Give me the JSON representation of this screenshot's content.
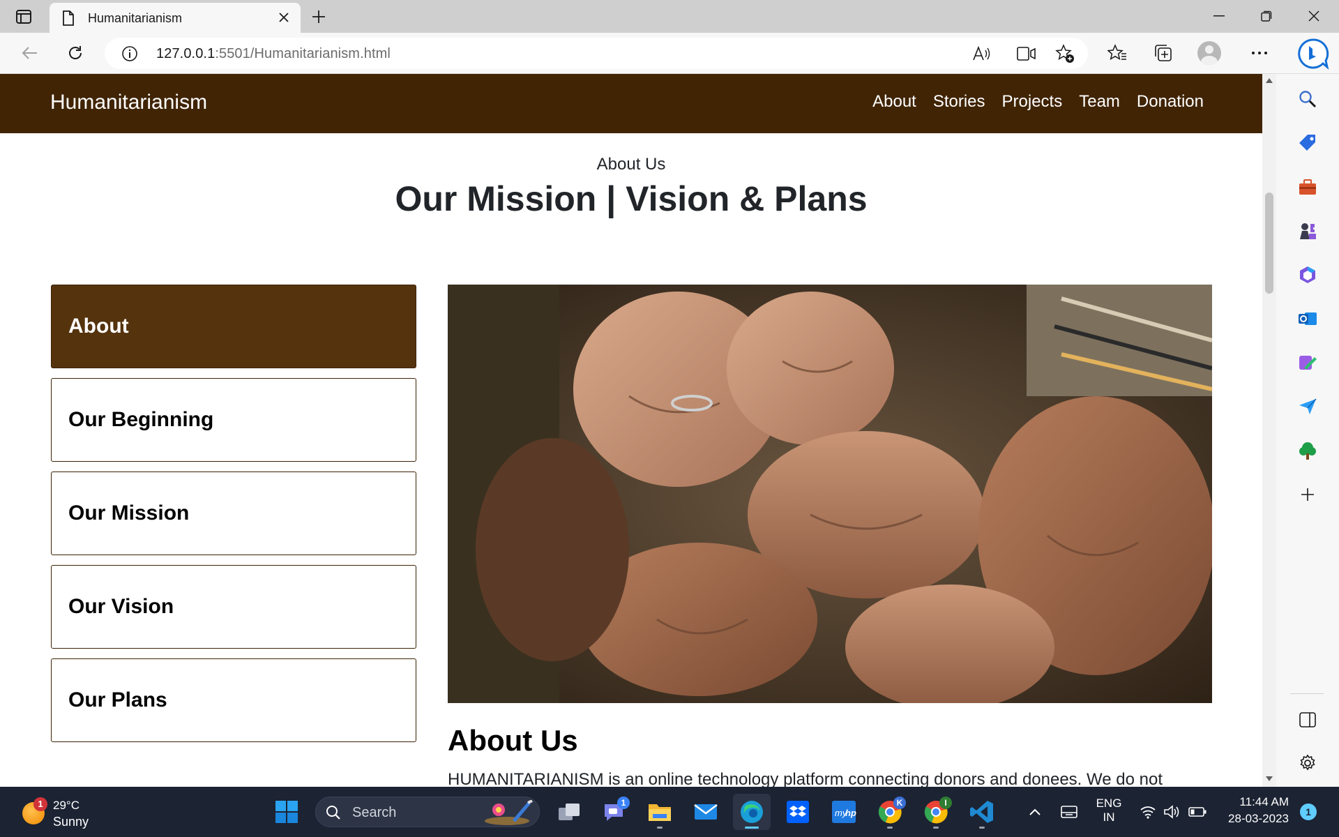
{
  "browser": {
    "tab_title": "Humanitarianism",
    "url_host": "127.0.0.1",
    "url_rest": ":5501/Humanitarianism.html"
  },
  "site": {
    "brand": "Humanitarianism",
    "nav": [
      "About",
      "Stories",
      "Projects",
      "Team",
      "Donation"
    ],
    "kicker": "About Us",
    "title": "Our Mission | Vision & Plans",
    "tabs": [
      {
        "label": "About",
        "active": true
      },
      {
        "label": "Our Beginning",
        "active": false
      },
      {
        "label": "Our Mission",
        "active": false
      },
      {
        "label": "Our Vision",
        "active": false
      },
      {
        "label": "Our Plans",
        "active": false
      }
    ],
    "about_heading": "About Us",
    "about_text": "HUMANITARIANISM is an online technology platform connecting donors and donees. We do not"
  },
  "colors": {
    "nav_bg": "#402404",
    "active_tab": "#55330d",
    "tab_border": "#3c2204"
  },
  "taskbar": {
    "weather_badge": "1",
    "temperature": "29°C",
    "condition": "Sunny",
    "search_placeholder": "Search",
    "teams_badge": "1",
    "chrome_badge_1": "K",
    "chrome_badge_2": "I",
    "language": "ENG",
    "region": "IN",
    "time": "11:44 AM",
    "date": "28-03-2023",
    "notifications": "1"
  }
}
